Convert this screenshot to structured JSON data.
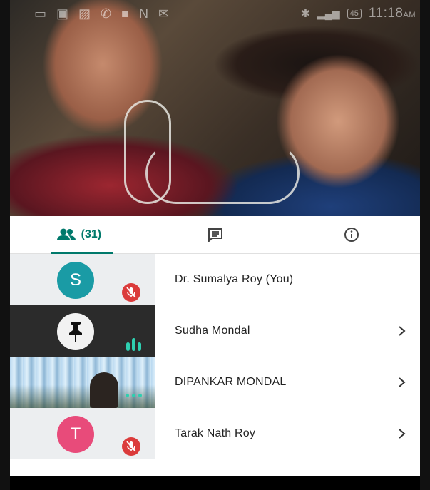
{
  "status_bar": {
    "time": "11:18",
    "ampm": "AM",
    "battery": "45"
  },
  "tabs": [
    {
      "name": "people",
      "count_label": "(31)",
      "active": true
    },
    {
      "name": "chat",
      "active": false
    },
    {
      "name": "info",
      "active": false
    }
  ],
  "participants": [
    {
      "name": "Dr. Sumalya Roy (You)",
      "initial": "S",
      "avatar_color": "#1a9ba5",
      "muted": true,
      "has_chevron": false
    },
    {
      "name": "Sudha Mondal",
      "initial": "",
      "muted": false,
      "speaking": true,
      "has_chevron": true
    },
    {
      "name": "DIPANKAR MONDAL",
      "initial": "",
      "muted": false,
      "more": true,
      "has_chevron": true
    },
    {
      "name": "Tarak Nath Roy",
      "initial": "T",
      "avatar_color": "#e84b7a",
      "muted": true,
      "has_chevron": true
    }
  ],
  "colors": {
    "accent": "#00796b",
    "mute_red": "#db3b3b",
    "speaking_green": "#2ecfb0"
  }
}
